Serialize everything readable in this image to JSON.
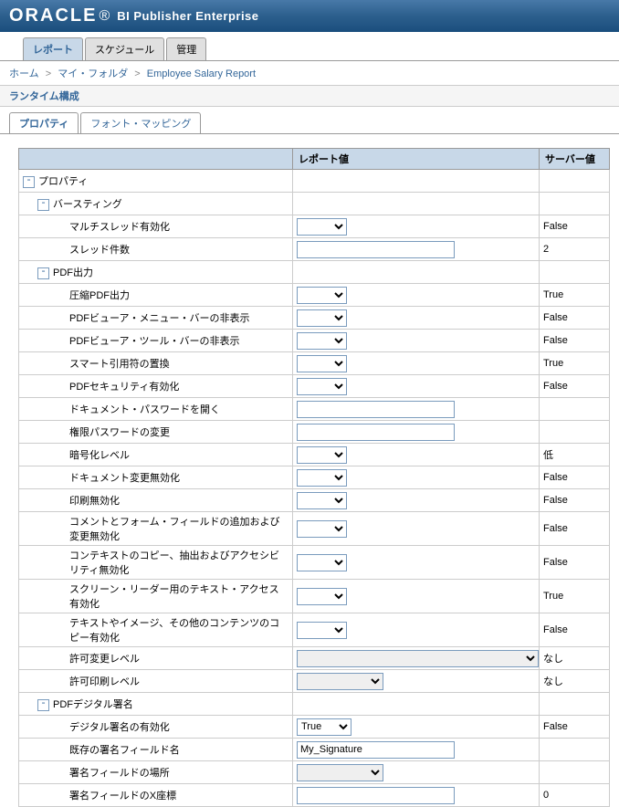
{
  "header": {
    "logo": "ORACLE",
    "product": "BI Publisher Enterprise"
  },
  "main_tabs": [
    {
      "label": "レポート",
      "active": true
    },
    {
      "label": "スケジュール",
      "active": false
    },
    {
      "label": "管理",
      "active": false
    }
  ],
  "breadcrumb": {
    "items": [
      "ホーム",
      "マイ・フォルダ",
      "Employee Salary Report"
    ]
  },
  "section_title": "ランタイム構成",
  "sub_tabs": [
    {
      "label": "プロパティ",
      "active": true
    },
    {
      "label": "フォント・マッピング",
      "active": false
    }
  ],
  "table": {
    "headers": {
      "label": "",
      "value": "レポート値",
      "server": "サーバー値"
    },
    "groups": {
      "root": "プロパティ",
      "bursting": "バースティング",
      "pdf": "PDF出力",
      "signature": "PDFデジタル署名"
    },
    "rows": {
      "multithread": {
        "label": "マルチスレッド有効化",
        "server": "False",
        "type": "select"
      },
      "threadcount": {
        "label": "スレッド件数",
        "server": "2",
        "type": "text",
        "value": ""
      },
      "compress": {
        "label": "圧縮PDF出力",
        "server": "True",
        "type": "select"
      },
      "hidemenu": {
        "label": "PDFビューア・メニュー・バーの非表示",
        "server": "False",
        "type": "select"
      },
      "hidetool": {
        "label": "PDFビューア・ツール・バーの非表示",
        "server": "False",
        "type": "select"
      },
      "smartquote": {
        "label": "スマート引用符の置換",
        "server": "True",
        "type": "select"
      },
      "security": {
        "label": "PDFセキュリティ有効化",
        "server": "False",
        "type": "select"
      },
      "docpass": {
        "label": "ドキュメント・パスワードを開く",
        "server": "",
        "type": "text",
        "value": ""
      },
      "permpass": {
        "label": "権限パスワードの変更",
        "server": "",
        "type": "text",
        "value": ""
      },
      "enclevel": {
        "label": "暗号化レベル",
        "server": "低",
        "type": "select"
      },
      "docchange": {
        "label": "ドキュメント変更無効化",
        "server": "False",
        "type": "select"
      },
      "printdis": {
        "label": "印刷無効化",
        "server": "False",
        "type": "select"
      },
      "comment": {
        "label": "コメントとフォーム・フィールドの追加および変更無効化",
        "server": "False",
        "type": "select"
      },
      "copydis": {
        "label": "コンテキストのコピー、抽出およびアクセシビリティ無効化",
        "server": "False",
        "type": "select"
      },
      "screenreader": {
        "label": "スクリーン・リーダー用のテキスト・アクセス有効化",
        "server": "True",
        "type": "select"
      },
      "textcopy": {
        "label": "テキストやイメージ、その他のコンテンツのコピー有効化",
        "server": "False",
        "type": "select"
      },
      "permchange": {
        "label": "許可変更レベル",
        "server": "なし",
        "type": "select-wide"
      },
      "permprint": {
        "label": "許可印刷レベル",
        "server": "なし",
        "type": "select-mid"
      },
      "sigenable": {
        "label": "デジタル署名の有効化",
        "server": "False",
        "type": "select-val",
        "value": "True"
      },
      "sigfield": {
        "label": "既存の署名フィールド名",
        "server": "",
        "type": "text",
        "value": "My_Signature"
      },
      "sigloc": {
        "label": "署名フィールドの場所",
        "server": "",
        "type": "select-mid"
      },
      "sigx": {
        "label": "署名フィールドのX座標",
        "server": "0",
        "type": "text",
        "value": ""
      }
    }
  }
}
